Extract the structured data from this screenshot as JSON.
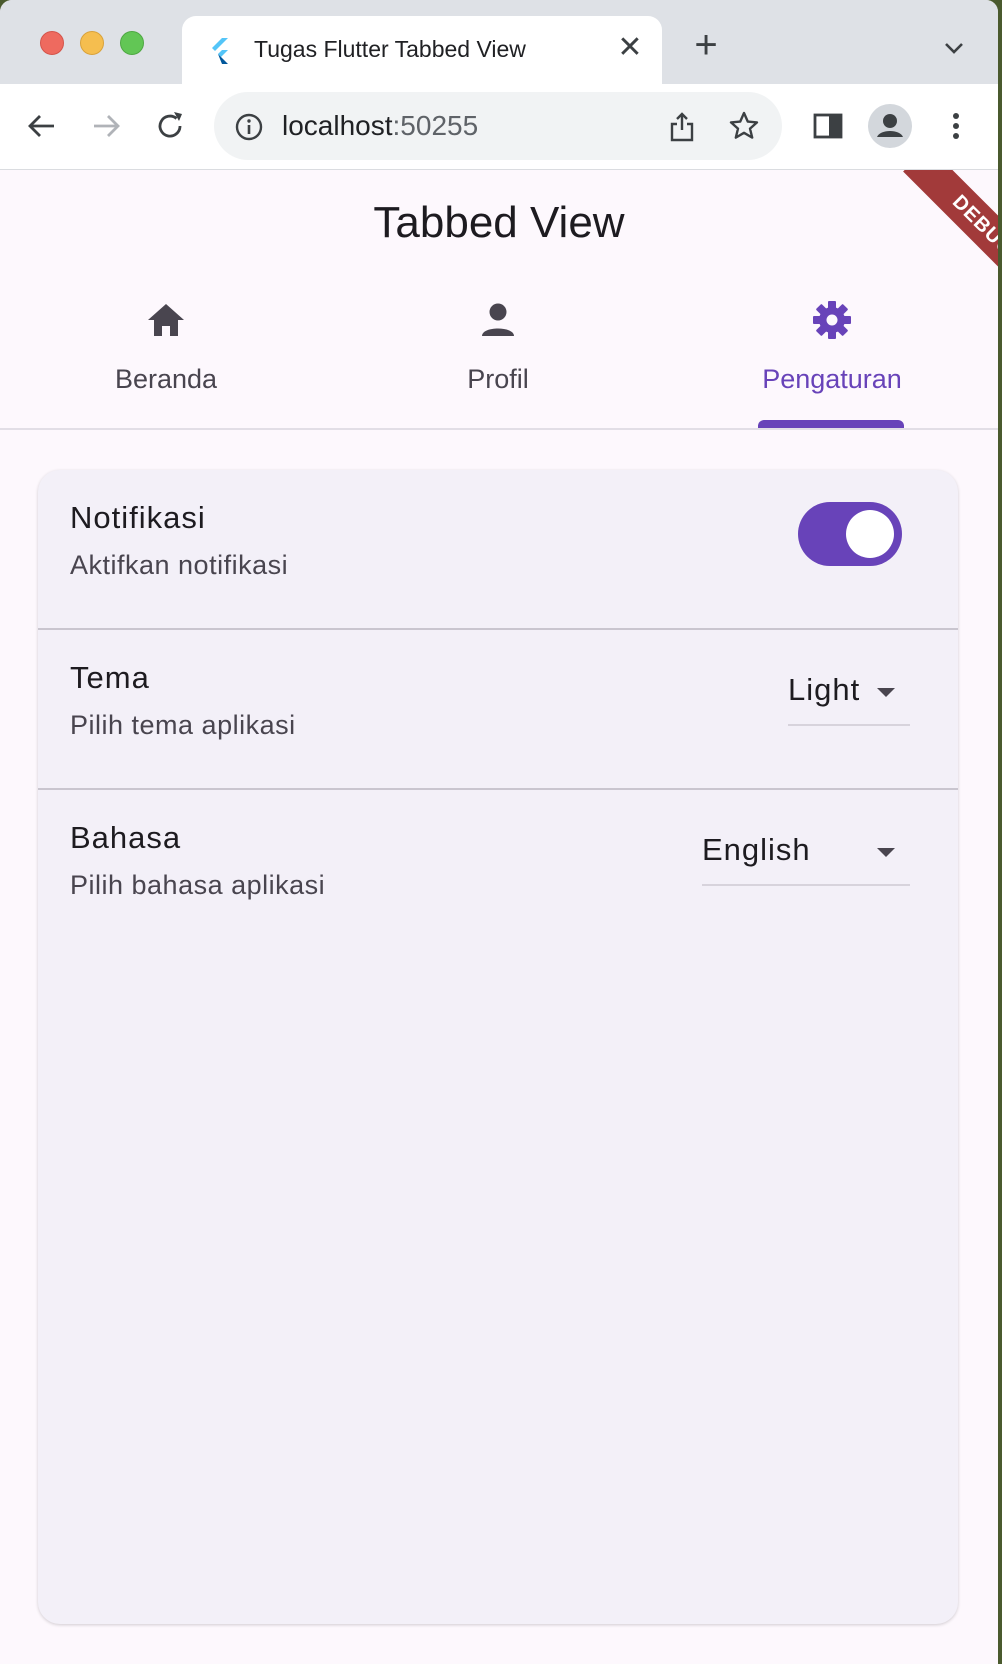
{
  "browser": {
    "tab_title": "Tugas Flutter Tabbed View",
    "tab_close": "✕",
    "new_tab": "+",
    "url_host": "localhost",
    "url_port": ":50255"
  },
  "app": {
    "title": "Tabbed View",
    "debug_banner": "DEBUG",
    "tabs": [
      {
        "label": "Beranda",
        "icon": "home-icon",
        "active": false
      },
      {
        "label": "Profil",
        "icon": "person-icon",
        "active": false
      },
      {
        "label": "Pengaturan",
        "icon": "gear-icon",
        "active": true
      }
    ],
    "settings": {
      "notifications": {
        "title": "Notifikasi",
        "subtitle": "Aktifkan notifikasi",
        "enabled": true
      },
      "theme": {
        "title": "Tema",
        "subtitle": "Pilih tema aplikasi",
        "value": "Light"
      },
      "language": {
        "title": "Bahasa",
        "subtitle": "Pilih bahasa aplikasi",
        "value": "English"
      }
    }
  },
  "colors": {
    "accent": "#6843b9",
    "icon_inactive": "#49454f",
    "card_bg": "#f3f0f8",
    "page_bg": "#fdf8fd",
    "debug_banner": "#a23a3a"
  }
}
